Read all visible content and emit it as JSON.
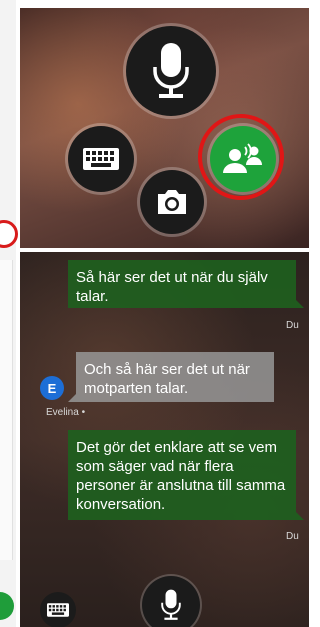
{
  "top_panel": {
    "buttons": {
      "mic": "microphone-icon",
      "keyboard": "keyboard-icon",
      "camera": "camera-icon",
      "conversation": "conversation-mode-icon"
    },
    "highlight_color": "#e01616",
    "accent_green": "#1ea33b"
  },
  "conversation": {
    "messages": [
      {
        "text": "Så här ser det ut när du själv talar.",
        "sender": "Du",
        "side": "self"
      },
      {
        "text": "Och så här ser det ut när motparten talar.",
        "sender": "Evelina",
        "avatar_letter": "E",
        "side": "other"
      },
      {
        "text": "Det gör det enklare att se vem som säger vad när flera personer är anslutna till samma konversation.",
        "sender": "Du",
        "side": "self"
      }
    ],
    "evelina_label": "Evelina •"
  },
  "bottom_bar": {
    "mic": "microphone-icon",
    "keyboard": "keyboard-icon"
  }
}
